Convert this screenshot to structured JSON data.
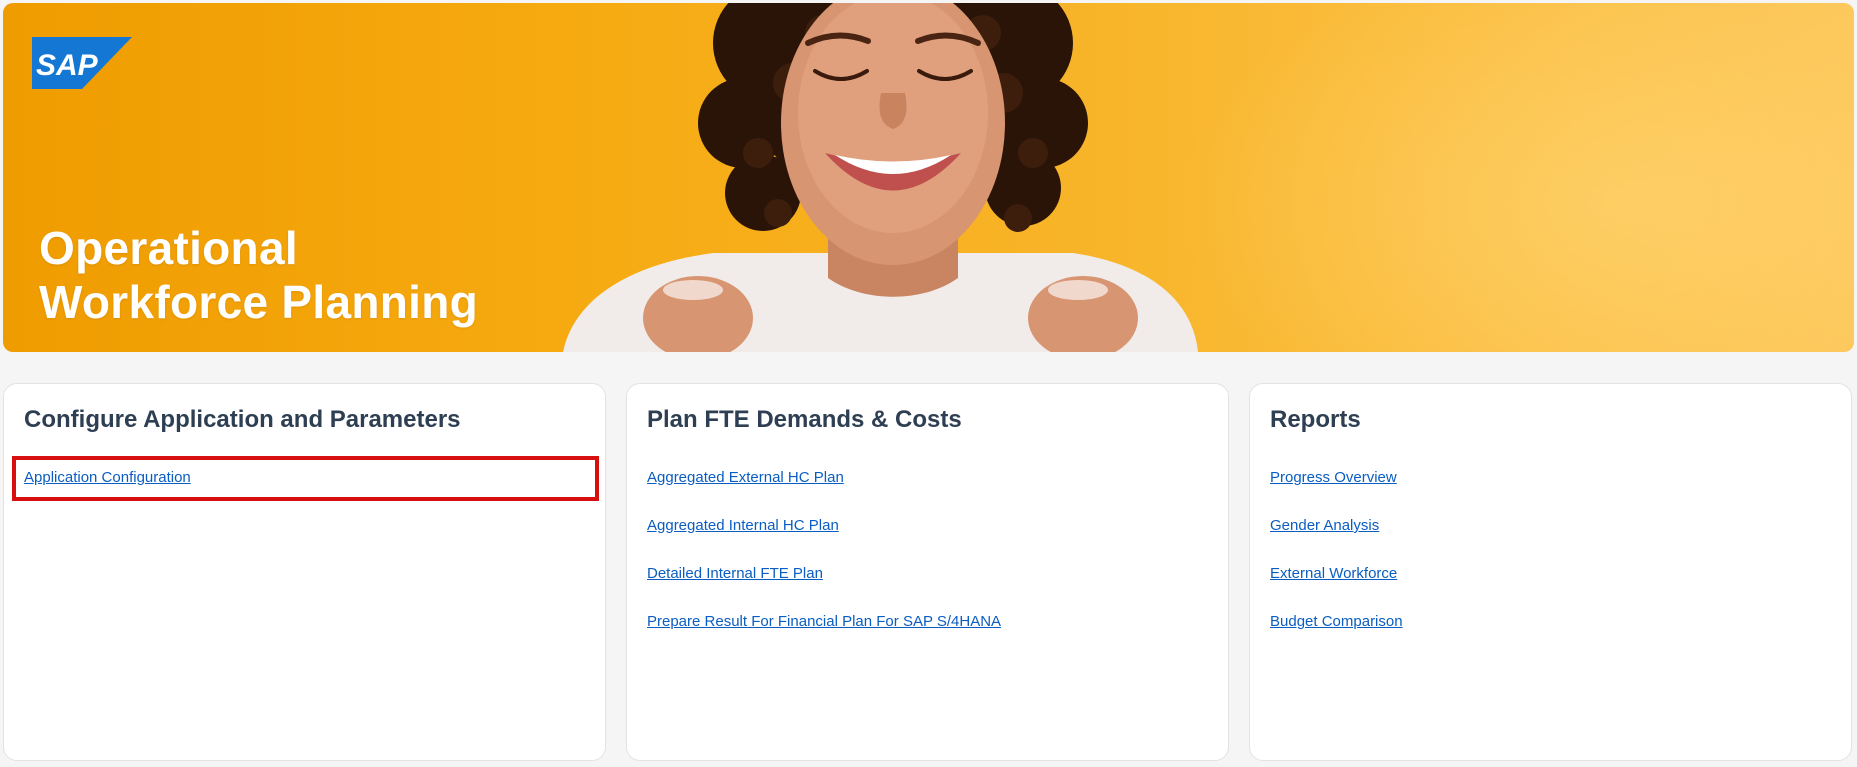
{
  "hero": {
    "title_line1": "Operational",
    "title_line2": "Workforce Planning",
    "logo_text": "SAP",
    "colors": {
      "banner_start": "#ef9c00",
      "banner_end": "#fdc75a",
      "logo_blue": "#1377d3"
    }
  },
  "cards": [
    {
      "title": "Configure Application and Parameters",
      "links": [
        "Application Configuration"
      ]
    },
    {
      "title": "Plan FTE Demands & Costs",
      "links": [
        "Aggregated External HC Plan",
        "Aggregated Internal HC Plan",
        "Detailed Internal FTE Plan",
        "Prepare Result For Financial Plan For SAP S/4HANA"
      ]
    },
    {
      "title": "Reports",
      "links": [
        "Progress Overview",
        "Gender Analysis",
        "External Workforce",
        "Budget Comparison"
      ]
    }
  ],
  "colors": {
    "link": "#0a5dc2",
    "heading": "#2f3f53",
    "highlight": "#d70f0f"
  }
}
